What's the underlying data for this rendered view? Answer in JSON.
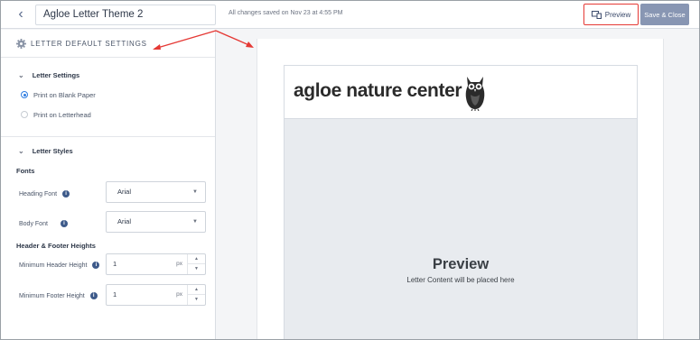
{
  "topbar": {
    "back_icon": "chevron-left-icon",
    "document_title": "Agloe Letter Theme 2",
    "save_status": "All changes saved on Nov 23 at 4:55 PM",
    "preview_label": "Preview",
    "preview_icon": "devices-icon",
    "save_close_label": "Save & Close"
  },
  "sidebar": {
    "header": "LETTER DEFAULT SETTINGS",
    "header_icon": "gear-icon",
    "letter_settings": {
      "title": "Letter Settings",
      "options": [
        {
          "label": "Print on Blank Paper",
          "selected": true
        },
        {
          "label": "Print on Letterhead",
          "selected": false
        }
      ]
    },
    "letter_styles": {
      "title": "Letter Styles",
      "fonts_heading": "Fonts",
      "heading_font": {
        "label": "Heading Font",
        "value": "Arial"
      },
      "body_font": {
        "label": "Body Font",
        "value": "Arial"
      },
      "heights_heading": "Header & Footer Heights",
      "min_header": {
        "label": "Minimum Header Height",
        "value": "1",
        "unit": "px"
      },
      "min_footer": {
        "label": "Minimum Footer Height",
        "value": "1",
        "unit": "px"
      }
    }
  },
  "preview": {
    "org_name": "agloe nature center",
    "logo_icon": "owl-icon",
    "title": "Preview",
    "subtitle": "Letter Content will be placed here"
  },
  "colors": {
    "annotation_red": "#e53935",
    "save_button": "#8896b3",
    "radio_selected": "#2f7de1",
    "content_area": "#e8ebef"
  }
}
